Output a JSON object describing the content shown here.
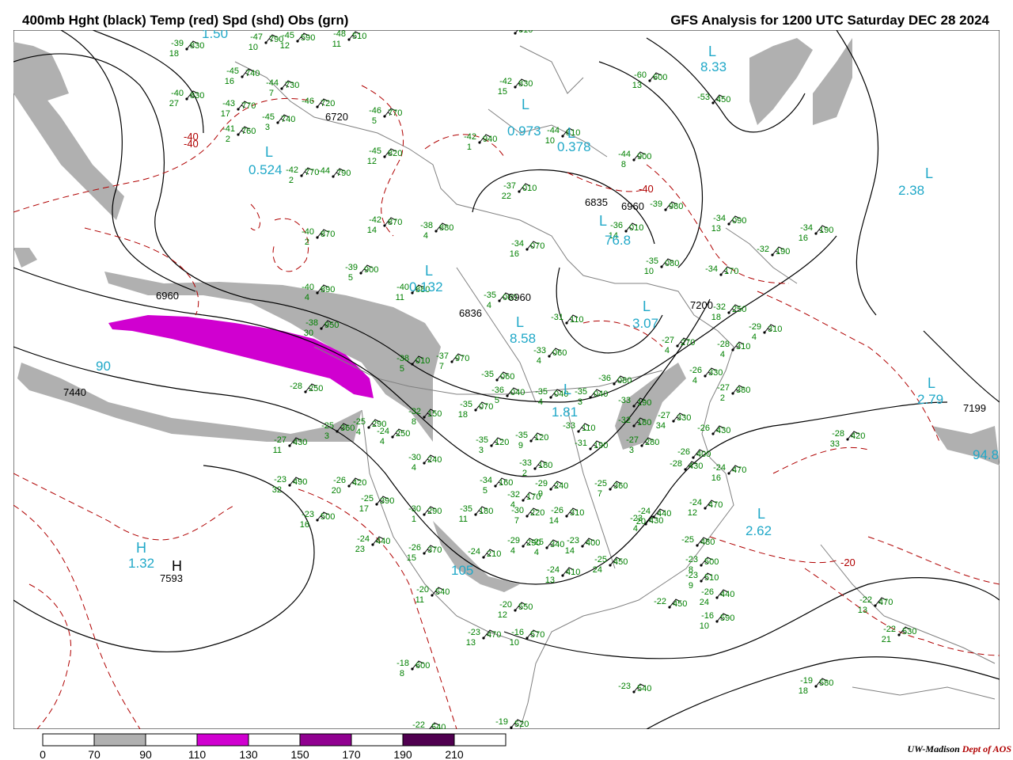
{
  "header": {
    "left_title": "400mb Hght (black) Temp (red) Spd (shd) Obs (grn)",
    "right_title": "GFS Analysis for 1200 UTC Saturday  DEC 28 2024"
  },
  "colors": {
    "height_contour": "#000000",
    "temp_contour": "#b00000",
    "obs_text": "#008000",
    "min_label": "#20a8c8",
    "geography": "#808080",
    "shade_70_90": "#b0b0b0",
    "shade_110_130": "#d000d0",
    "shade_150_170": "#900090",
    "shade_190_210": "#500050"
  },
  "height_labels": [
    {
      "text": "6720"
    },
    {
      "text": "6960"
    },
    {
      "text": "7440"
    },
    {
      "text": "6836"
    },
    {
      "text": "6960"
    },
    {
      "text": "6835"
    },
    {
      "text": "6960"
    },
    {
      "text": "7200"
    },
    {
      "text": "7199"
    },
    {
      "text": "7593"
    }
  ],
  "temp_labels": [
    {
      "text": "-40"
    },
    {
      "text": "-40"
    },
    {
      "text": "-40"
    },
    {
      "text": "-20"
    }
  ],
  "center_markers": [
    {
      "text": "L"
    },
    {
      "text": "L"
    },
    {
      "text": "L"
    },
    {
      "text": "L"
    },
    {
      "text": "L"
    },
    {
      "text": "L"
    },
    {
      "text": "L"
    },
    {
      "text": "L"
    },
    {
      "text": "L"
    },
    {
      "text": "L"
    },
    {
      "text": "L"
    },
    {
      "text": "L"
    },
    {
      "text": "H"
    },
    {
      "text": "H"
    }
  ],
  "center_values": [
    {
      "text": "8.33"
    },
    {
      "text": "0.973"
    },
    {
      "text": "0.378"
    },
    {
      "text": "2.38"
    },
    {
      "text": "0.524"
    },
    {
      "text": "0.132"
    },
    {
      "text": "76.8"
    },
    {
      "text": "3.07"
    },
    {
      "text": "8.58"
    },
    {
      "text": "1.81"
    },
    {
      "text": "2.79"
    },
    {
      "text": "2.62"
    },
    {
      "text": "1.32"
    },
    {
      "text": "105"
    },
    {
      "text": "90"
    },
    {
      "text": "94.8"
    },
    {
      "text": "1.50"
    }
  ],
  "observations": [
    {
      "t": "-39",
      "h": "830",
      "d": "18"
    },
    {
      "t": "-47",
      "h": "790",
      "d": "10"
    },
    {
      "t": "-45",
      "h": "590",
      "d": "12"
    },
    {
      "t": "-48",
      "h": "510",
      "d": "11"
    },
    {
      "t": "-45",
      "h": "610",
      "d": ""
    },
    {
      "t": "-45",
      "h": "740",
      "d": "16"
    },
    {
      "t": "-44",
      "h": "730",
      "d": "7"
    },
    {
      "t": "-40",
      "h": "830",
      "d": "27"
    },
    {
      "t": "-43",
      "h": "770",
      "d": "17"
    },
    {
      "t": "-46",
      "h": "720",
      "d": ""
    },
    {
      "t": "-45",
      "h": "740",
      "d": "3"
    },
    {
      "t": "-41",
      "h": "760",
      "d": "2"
    },
    {
      "t": "-46",
      "h": "770",
      "d": "5"
    },
    {
      "t": "-42",
      "h": "830",
      "d": "15"
    },
    {
      "t": "-60",
      "h": "600",
      "d": "13"
    },
    {
      "t": "-53",
      "h": "450",
      "d": ""
    },
    {
      "t": "-42",
      "h": "940",
      "d": "1"
    },
    {
      "t": "-44",
      "h": "810",
      "d": "10"
    },
    {
      "t": "-45",
      "h": "820",
      "d": "12"
    },
    {
      "t": "-42",
      "h": "770",
      "d": "2"
    },
    {
      "t": "-44",
      "h": "790",
      "d": ""
    },
    {
      "t": "-44",
      "h": "900",
      "d": "8"
    },
    {
      "t": "-37",
      "h": "010",
      "d": "22"
    },
    {
      "t": "-39",
      "h": "980",
      "d": ""
    },
    {
      "t": "-42",
      "h": "870",
      "d": "14"
    },
    {
      "t": "-38",
      "h": "880",
      "d": "4"
    },
    {
      "t": "-40",
      "h": "870",
      "d": "2"
    },
    {
      "t": "-34",
      "h": "070",
      "d": "16"
    },
    {
      "t": "-36",
      "h": "010",
      "d": "14"
    },
    {
      "t": "-34",
      "h": "090",
      "d": "13"
    },
    {
      "t": "-34",
      "h": "190",
      "d": "16"
    },
    {
      "t": "-32",
      "h": "190",
      "d": ""
    },
    {
      "t": "-39",
      "h": "900",
      "d": "5"
    },
    {
      "t": "-40",
      "h": "880",
      "d": "11"
    },
    {
      "t": "-35",
      "h": "080",
      "d": "10"
    },
    {
      "t": "-34",
      "h": "170",
      "d": ""
    },
    {
      "t": "-40",
      "h": "890",
      "d": "4"
    },
    {
      "t": "-35",
      "h": "000",
      "d": "4"
    },
    {
      "t": "-31",
      "h": "110",
      "d": ""
    },
    {
      "t": "-32",
      "h": "250",
      "d": "18"
    },
    {
      "t": "-29",
      "h": "310",
      "d": "4"
    },
    {
      "t": "-38",
      "h": "950",
      "d": "30"
    },
    {
      "t": "-37",
      "h": "970",
      "d": "7"
    },
    {
      "t": "-27",
      "h": "270",
      "d": "4"
    },
    {
      "t": "-28",
      "h": "310",
      "d": "4"
    },
    {
      "t": "-38",
      "h": "010",
      "d": "5"
    },
    {
      "t": "-33",
      "h": "060",
      "d": "4"
    },
    {
      "t": "-35",
      "h": "060",
      "d": ""
    },
    {
      "t": "-26",
      "h": "330",
      "d": "4"
    },
    {
      "t": "-28",
      "h": "250",
      "d": ""
    },
    {
      "t": "-36",
      "h": "040",
      "d": "5"
    },
    {
      "t": "-35",
      "h": "040",
      "d": "4"
    },
    {
      "t": "-35",
      "h": "040",
      "d": "3"
    },
    {
      "t": "-36",
      "h": "080",
      "d": ""
    },
    {
      "t": "-33",
      "h": "190",
      "d": ""
    },
    {
      "t": "-27",
      "h": "380",
      "d": "2"
    },
    {
      "t": "-35",
      "h": "070",
      "d": "18"
    },
    {
      "t": "-32",
      "h": "150",
      "d": "8"
    },
    {
      "t": "-32",
      "h": "180",
      "d": ""
    },
    {
      "t": "-27",
      "h": "330",
      "d": "34"
    },
    {
      "t": "-25",
      "h": "360",
      "d": "3"
    },
    {
      "t": "-25",
      "h": "290",
      "d": "4"
    },
    {
      "t": "-24",
      "h": "250",
      "d": "4"
    },
    {
      "t": "-26",
      "h": "430",
      "d": ""
    },
    {
      "t": "-28",
      "h": "420",
      "d": "33"
    },
    {
      "t": "-27",
      "h": "430",
      "d": "11"
    },
    {
      "t": "-35",
      "h": "120",
      "d": "3"
    },
    {
      "t": "-35",
      "h": "120",
      "d": "9"
    },
    {
      "t": "-33",
      "h": "110",
      "d": ""
    },
    {
      "t": "-31",
      "h": "190",
      "d": ""
    },
    {
      "t": "-27",
      "h": "280",
      "d": "3"
    },
    {
      "t": "-26",
      "h": "400",
      "d": ""
    },
    {
      "t": "-24",
      "h": "470",
      "d": "16"
    },
    {
      "t": "-30",
      "h": "240",
      "d": "4"
    },
    {
      "t": "-33",
      "h": "180",
      "d": "2"
    },
    {
      "t": "-28",
      "h": "430",
      "d": ""
    },
    {
      "t": "-23",
      "h": "490",
      "d": "32"
    },
    {
      "t": "-26",
      "h": "420",
      "d": "20"
    },
    {
      "t": "-34",
      "h": "160",
      "d": "5"
    },
    {
      "t": "-29",
      "h": "240",
      "d": "9"
    },
    {
      "t": "-25",
      "h": "360",
      "d": "7"
    },
    {
      "t": "-24",
      "h": "470",
      "d": "12"
    },
    {
      "t": "-25",
      "h": "390",
      "d": "17"
    },
    {
      "t": "-32",
      "h": "170",
      "d": "4"
    },
    {
      "t": "-23",
      "h": "500",
      "d": "16"
    },
    {
      "t": "-30",
      "h": "290",
      "d": "1"
    },
    {
      "t": "-35",
      "h": "180",
      "d": "11"
    },
    {
      "t": "-30",
      "h": "220",
      "d": "7"
    },
    {
      "t": "-26",
      "h": "310",
      "d": "14"
    },
    {
      "t": "-23",
      "h": "430",
      "d": "4"
    },
    {
      "t": "-24",
      "h": "440",
      "d": "20"
    },
    {
      "t": "-24",
      "h": "440",
      "d": "23"
    },
    {
      "t": "-29",
      "h": "290",
      "d": "4"
    },
    {
      "t": "-25",
      "h": "340",
      "d": "4"
    },
    {
      "t": "-23",
      "h": "400",
      "d": "14"
    },
    {
      "t": "-25",
      "h": "480",
      "d": ""
    },
    {
      "t": "-26",
      "h": "370",
      "d": "15"
    },
    {
      "t": "-24",
      "h": "210",
      "d": ""
    },
    {
      "t": "-22",
      "h": "450",
      "d": ""
    },
    {
      "t": "-23",
      "h": "500",
      "d": "8"
    },
    {
      "t": "-24",
      "h": "410",
      "d": "13"
    },
    {
      "t": "-23",
      "h": "510",
      "d": "9"
    },
    {
      "t": "-25",
      "h": "450",
      "d": "24"
    },
    {
      "t": "-20",
      "h": "540",
      "d": "11"
    },
    {
      "t": "-26",
      "h": "440",
      "d": "24"
    },
    {
      "t": "-20",
      "h": "550",
      "d": "12"
    },
    {
      "t": "-16",
      "h": "590",
      "d": "10"
    },
    {
      "t": "-22",
      "h": "470",
      "d": "13"
    },
    {
      "t": "-23",
      "h": "470",
      "d": "13"
    },
    {
      "t": "-16",
      "h": "570",
      "d": "10"
    },
    {
      "t": "-22",
      "h": "530",
      "d": "21"
    },
    {
      "t": "-18",
      "h": "600",
      "d": "8"
    },
    {
      "t": "-19",
      "h": "580",
      "d": "18"
    },
    {
      "t": "-23",
      "h": "540",
      "d": ""
    },
    {
      "t": "-22",
      "h": "540",
      "d": ""
    },
    {
      "t": "-19",
      "h": "520",
      "d": ""
    }
  ],
  "colorbar": {
    "ticks": [
      "0",
      "70",
      "90",
      "110",
      "130",
      "150",
      "170",
      "190",
      "210"
    ]
  },
  "credit": {
    "org": "UW-Madison",
    "dept": "Dept of AOS"
  }
}
